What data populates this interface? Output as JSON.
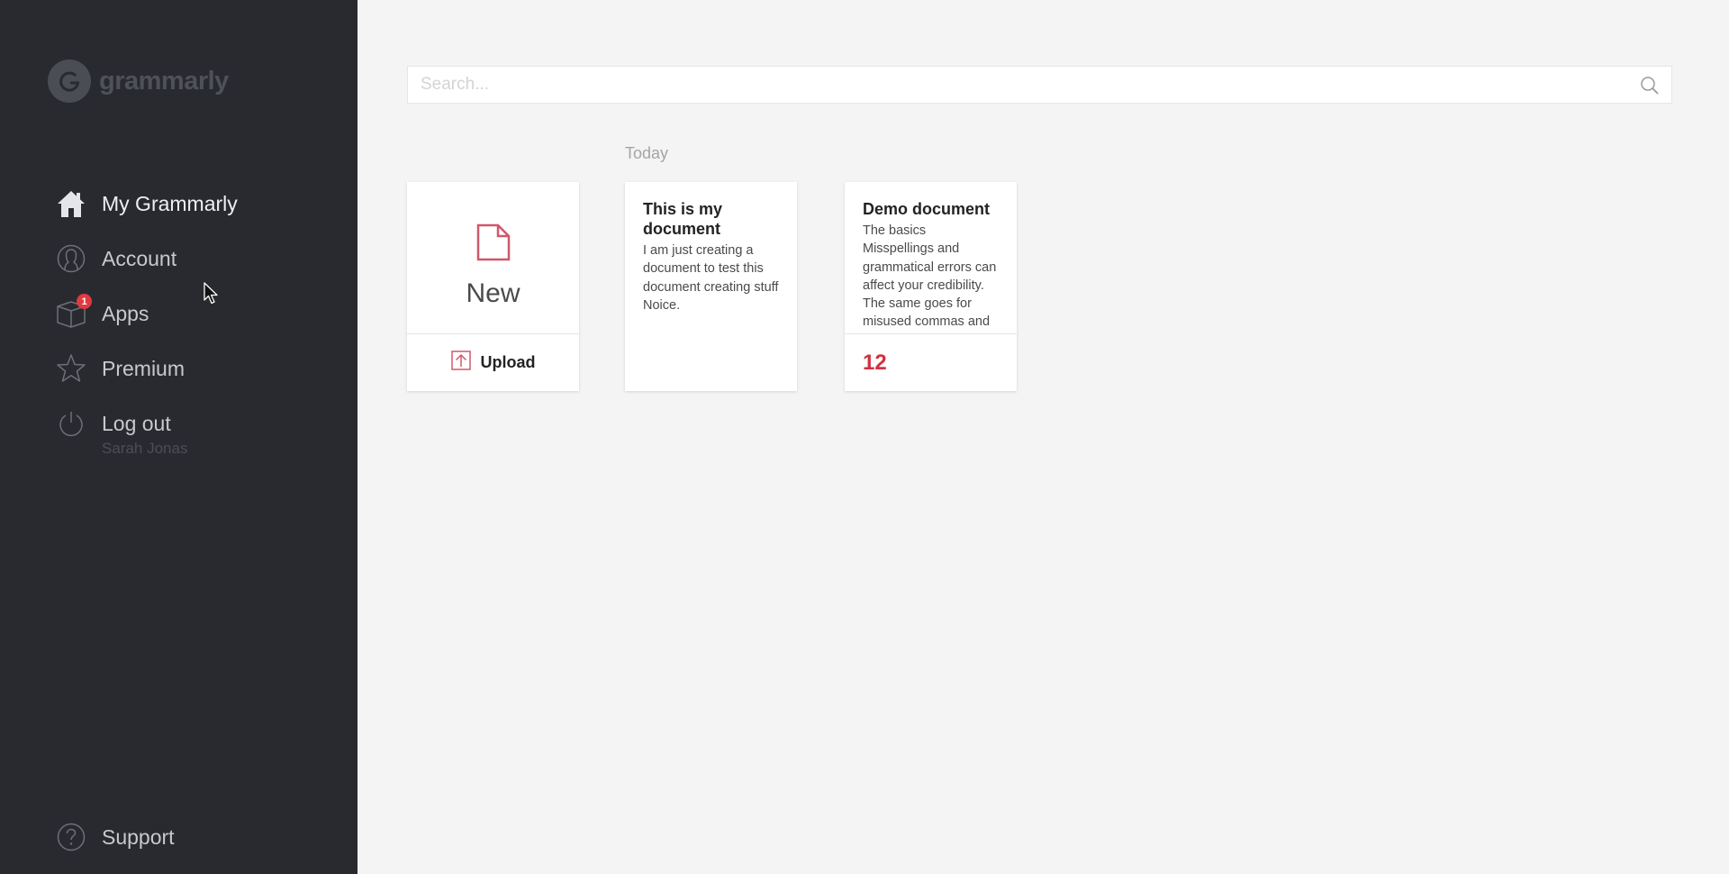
{
  "app": {
    "logo_text": "grammarly"
  },
  "sidebar": {
    "items": [
      {
        "label": "My Grammarly",
        "icon": "home-icon",
        "active": true
      },
      {
        "label": "Account",
        "icon": "account-icon"
      },
      {
        "label": "Apps",
        "icon": "apps-box-icon",
        "badge": "1"
      },
      {
        "label": "Premium",
        "icon": "star-icon"
      },
      {
        "label": "Log out",
        "icon": "power-icon"
      }
    ],
    "username": "Sarah Jonas",
    "support_label": "Support"
  },
  "search": {
    "placeholder": "Search...",
    "value": ""
  },
  "main": {
    "section_label": "Today",
    "new_card": {
      "label": "New",
      "upload_label": "Upload"
    },
    "documents": [
      {
        "title": "This is my document",
        "preview": "I am just creating a document to test this document creating stuff Noice.",
        "score": ""
      },
      {
        "title": "Demo document",
        "preview": "The basics Misspellings and grammatical errors can affect your credibility. The same goes for misused commas and other",
        "score": "12"
      }
    ]
  },
  "colors": {
    "sidebar_bg": "#292a30",
    "page_bg": "#f4f4f4",
    "accent_red": "#d0323f",
    "badge_red": "#e0393f"
  }
}
